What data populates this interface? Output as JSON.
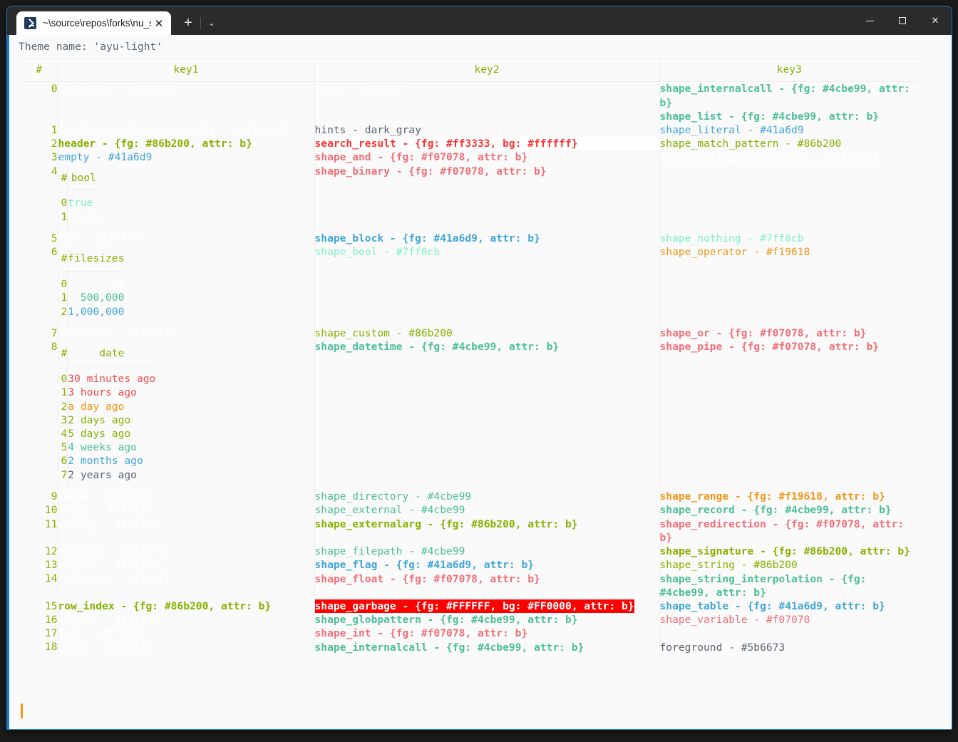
{
  "window": {
    "tab_title": "~\\source\\repos\\forks\\nu_scrip",
    "tab_icon": "terminal-icon",
    "close_label": "✕",
    "new_tab_label": "+",
    "dropdown_label": "⌄",
    "minimize_label": "minimize-icon",
    "maximize_label": "maximize-icon",
    "close_window_label": "✕"
  },
  "terminal": {
    "theme_line": "Theme name: 'ayu-light'",
    "prompt_cursor": "|"
  },
  "table": {
    "headers": [
      "#",
      "key1",
      "key2",
      "key3"
    ],
    "rows": [
      {
        "idx": "0",
        "k1": "separator - #ffffff",
        "k1c": "c-white",
        "k2": "block - #ffffff",
        "k2c": "c-white",
        "k3": "shape_internalcall - {fg: #4cbe99, attr: b}",
        "k3c": "c-tealb"
      },
      {
        "idx": "",
        "k1": "",
        "k2": "",
        "k3": "shape_list - {fg: #4cbe99, attr: b}",
        "k3c": "c-tealb"
      },
      {
        "idx": "1",
        "k1": "leading_trailing_space_bg - {attr: n}",
        "k1c": "c-white",
        "k2": "hints - dark_gray",
        "k2c": "c-gray",
        "k3": "shape_literal - #41a6d9",
        "k3c": "c-bluep"
      },
      {
        "idx": "2",
        "k1": "header - {fg: #86b200, attr: b}",
        "k1c": "c-green",
        "k2": "search_result - {fg: #ff3333, bg: #ffffff}",
        "k2c": "c-red",
        "k3": "shape_match_pattern - #86b200",
        "k3c": "c-greenp"
      },
      {
        "idx": "3",
        "k1": "empty - #41a6d9",
        "k1c": "c-bluep",
        "k2": "shape_and - {fg: #f07078, attr: b}",
        "k2c": "c-pinkb",
        "k3": "shape_matching_brackets - {attr: u}",
        "k3c": "c-whiteu"
      },
      {
        "idx": "4",
        "k1": "",
        "k2": "shape_binary - {fg: #f07078, attr: b}",
        "k2c": "c-pinkb",
        "k3": ""
      },
      {
        "idx": "5",
        "k1": "int - #ffffff",
        "k1c": "c-white",
        "k2": "shape_block - {fg: #41a6d9, attr: b}",
        "k2c": "c-blueb",
        "k3": "shape_nothing - #7ff0cb",
        "k3c": "c-mint"
      },
      {
        "idx": "6",
        "k1": "",
        "k2": "shape_bool - #7ff0cb",
        "k2c": "c-mint",
        "k3": "shape_operator - #f19618",
        "k3c": "c-orange"
      },
      {
        "idx": "7",
        "k1": "duration - #ffffff",
        "k1c": "c-white",
        "k2": "shape_custom - #86b200",
        "k2c": "c-greenp",
        "k3": "shape_or - {fg: #f07078, attr: b}",
        "k3c": "c-pinkb"
      },
      {
        "idx": "8",
        "k1": "",
        "k2": "shape_datetime - {fg: #4cbe99, attr: b}",
        "k2c": "c-tealb",
        "k3": "shape_pipe - {fg: #f07078, attr: b}",
        "k3c": "c-pinkb"
      },
      {
        "idx": "9",
        "k1": "range - #ffffff",
        "k1c": "c-white",
        "k2": "shape_directory - #4cbe99",
        "k2c": "c-teal",
        "k3": "shape_range - {fg: #f19618, attr: b}",
        "k3c": "c-orangeb"
      },
      {
        "idx": "10",
        "k1": "float - #ffffff",
        "k1c": "c-white",
        "k2": "shape_external - #4cbe99",
        "k2c": "c-teal",
        "k3": "shape_record - {fg: #4cbe99, attr: b}",
        "k3c": "c-tealb"
      },
      {
        "idx": "11",
        "k1": "string - #ffffff",
        "k1c": "c-white",
        "k2": "shape_externalarg - {fg: #86b200, attr: b}",
        "k2c": "c-green",
        "k3": "shape_redirection - {fg: #f07078, attr: b}",
        "k3c": "c-pinkb"
      },
      {
        "idx": "12",
        "k1": "nothing - #ffffff",
        "k1c": "c-white",
        "k2": "shape_filepath - #4cbe99",
        "k2c": "c-teal",
        "k3": "shape_signature - {fg: #86b200, attr: b}",
        "k3c": "c-green"
      },
      {
        "idx": "13",
        "k1": "binary - #ffffff",
        "k1c": "c-white",
        "k2": "shape_flag - {fg: #41a6d9, attr: b}",
        "k2c": "c-blueb",
        "k3": "shape_string - #86b200",
        "k3c": "c-greenp"
      },
      {
        "idx": "14",
        "k1": "cellpath - #ffffff",
        "k1c": "c-white",
        "k2": "shape_float - {fg: #f07078, attr: b}",
        "k2c": "c-pinkb",
        "k3": "shape_string_interpolation - {fg: #4cbe99, attr: b}",
        "k3c": "c-tealb"
      },
      {
        "idx": "15",
        "k1": "row_index - {fg: #86b200, attr: b}",
        "k1c": "c-green",
        "k2": "shape_garbage - {fg: #FFFFFF, bg: #FF0000, attr: b}",
        "k2c": "c-garbage",
        "k3": "shape_table - {fg: #41a6d9, attr: b}",
        "k3c": "c-blueb"
      },
      {
        "idx": "16",
        "k1": "record - #ffffff",
        "k1c": "c-white",
        "k2": "shape_globpattern - {fg: #4cbe99, attr: b}",
        "k2c": "c-tealb",
        "k3": "shape_variable - #f07078",
        "k3c": "c-pink"
      },
      {
        "idx": "17",
        "k1": "list - #ffffff",
        "k1c": "c-white",
        "k2": "shape_int - {fg: #f07078, attr: b}",
        "k2c": "c-pinkb",
        "k3": ""
      },
      {
        "idx": "18",
        "k1": "block - #ffffff",
        "k1c": "c-white",
        "k2": "shape_internalcall - {fg: #4cbe99, attr: b}",
        "k2c": "c-tealb",
        "k3": "foreground - #5b6673",
        "k3c": "c-gray"
      }
    ]
  },
  "nested_bool": {
    "headers": [
      "#",
      "bool"
    ],
    "rows": [
      {
        "i": "0",
        "v": "true",
        "c": "c-mint"
      },
      {
        "i": "1",
        "v": "false",
        "c": "c-white"
      }
    ]
  },
  "nested_filesizes": {
    "headers": [
      "#",
      "filesizes"
    ],
    "rows": [
      {
        "i": "0",
        "v": "0",
        "c": "c-white"
      },
      {
        "i": "1",
        "v": "500,000",
        "c": "c-teal"
      },
      {
        "i": "2",
        "v": "1,000,000",
        "c": "c-bluep"
      }
    ]
  },
  "nested_date": {
    "headers": [
      "#",
      "date"
    ],
    "rows": [
      {
        "i": "0",
        "v": "30 minutes ago",
        "c": "c-red-plain"
      },
      {
        "i": "1",
        "v": "3 hours ago",
        "c": "c-red-plain"
      },
      {
        "i": "2",
        "v": "a day ago",
        "c": "c-orange"
      },
      {
        "i": "3",
        "v": "2 days ago",
        "c": "c-greenp"
      },
      {
        "i": "4",
        "v": "5 days ago",
        "c": "c-greenp"
      },
      {
        "i": "5",
        "v": "4 weeks ago",
        "c": "c-teal"
      },
      {
        "i": "6",
        "v": "2 months ago",
        "c": "c-bluep"
      },
      {
        "i": "7",
        "v": "2 years ago",
        "c": "c-gray"
      }
    ]
  },
  "colors": {
    "accent_blue": "#41a6d9",
    "green": "#86b200",
    "teal": "#4cbe99",
    "mint": "#7ff0cb",
    "pink": "#f07078",
    "orange": "#f19618",
    "gray": "#5b6673",
    "red": "#ff3333",
    "garbage_bg": "#FF0000",
    "window_border": "#1f77c4",
    "background": "#fafafa"
  }
}
